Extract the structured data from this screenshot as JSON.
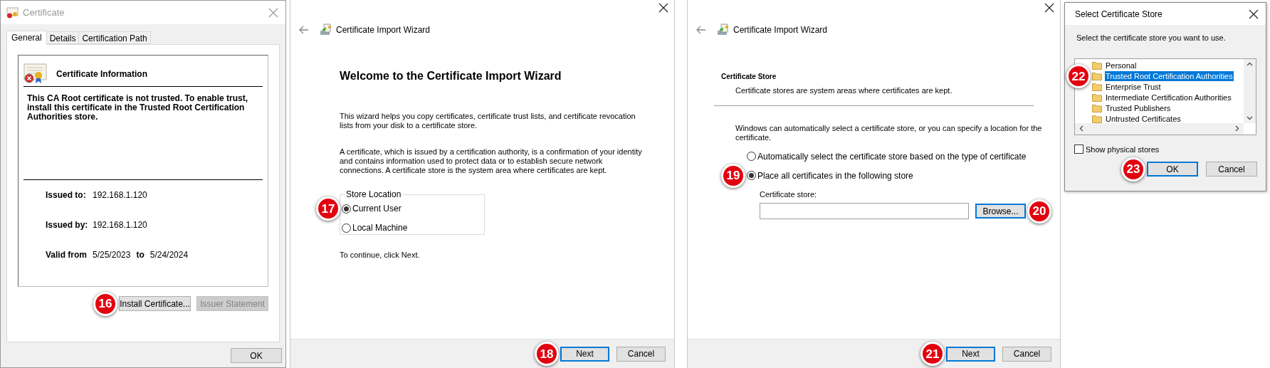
{
  "certificate_dialog": {
    "title": "Certificate",
    "tabs": [
      {
        "label": "General",
        "selected": true
      },
      {
        "label": "Details",
        "selected": false
      },
      {
        "label": "Certification Path",
        "selected": false
      }
    ],
    "info_title": "Certificate Information",
    "message": "This CA Root certificate is not trusted. To enable trust, install this certificate in the Trusted Root Certification Authorities store.",
    "fields": [
      {
        "label": "Issued to:",
        "value": "192.168.1.120"
      },
      {
        "label": "Issued by:",
        "value": "192.168.1.120"
      }
    ],
    "validity": {
      "label": "Valid from",
      "from": "5/25/2023",
      "to_label": "to",
      "to": "5/24/2024"
    },
    "buttons": [
      {
        "label": "Install Certificate...",
        "disabled": false,
        "badge": "16"
      },
      {
        "label": "Issuer Statement",
        "disabled": true
      }
    ],
    "ok_button": "OK"
  },
  "welcome_wizard": {
    "title": "Certificate Import Wizard",
    "heading": "Welcome to the Certificate Import Wizard",
    "paragraphs": [
      "This wizard helps you copy certificates, certificate trust lists, and certificate revocation lists from your disk to a certificate store.",
      "A certificate, which is issued by a certification authority, is a confirmation of your identity and contains information used to protect data or to establish secure network connections. A certificate store is the system area where certificates are kept."
    ],
    "group_label": "Store Location",
    "options": [
      {
        "label": "Current User",
        "selected": true,
        "badge": "17"
      },
      {
        "label": "Local Machine",
        "selected": false
      }
    ],
    "hint": "To continue, click Next.",
    "buttons": [
      {
        "label": "Next",
        "default": true,
        "badge": "18"
      },
      {
        "label": "Cancel",
        "default": false
      }
    ]
  },
  "store_wizard": {
    "title": "Certificate Import Wizard",
    "section_title": "Certificate Store",
    "section_subtitle": "Certificate stores are system areas where certificates are kept.",
    "paragraph": "Windows can automatically select a certificate store, or you can specify a location for the certificate.",
    "options": [
      {
        "label": "Automatically select the certificate store based on the type of certificate",
        "selected": false
      },
      {
        "label": "Place all certificates in the following store",
        "selected": true,
        "badge": "19"
      }
    ],
    "store_label": "Certificate store:",
    "browse_button": {
      "label": "Browse...",
      "default": true,
      "badge": "20"
    },
    "buttons": [
      {
        "label": "Next",
        "default": true,
        "badge": "21"
      },
      {
        "label": "Cancel",
        "default": false
      }
    ]
  },
  "select_store_dialog": {
    "title": "Select Certificate Store",
    "prompt": "Select the certificate store you want to use.",
    "stores": [
      {
        "label": "Personal",
        "selected": false
      },
      {
        "label": "Trusted Root Certification Authorities",
        "selected": true,
        "badge": "22"
      },
      {
        "label": "Enterprise Trust",
        "selected": false
      },
      {
        "label": "Intermediate Certification Authorities",
        "selected": false
      },
      {
        "label": "Trusted Publishers",
        "selected": false
      },
      {
        "label": "Untrusted Certificates",
        "selected": false
      }
    ],
    "show_physical": {
      "label": "Show physical stores",
      "checked": false
    },
    "buttons": [
      {
        "label": "OK",
        "default": true,
        "badge": "23"
      },
      {
        "label": "Cancel",
        "default": false
      }
    ]
  }
}
